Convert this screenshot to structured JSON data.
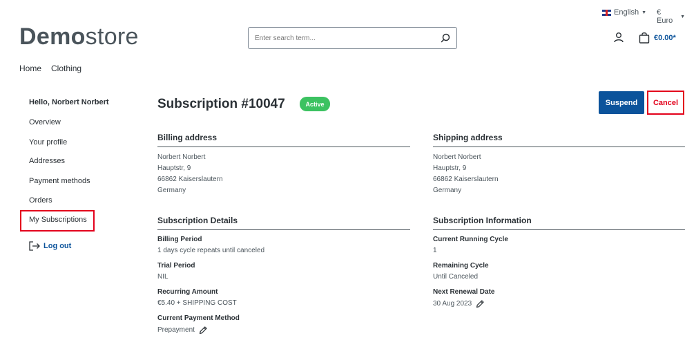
{
  "topbar": {
    "language": "English",
    "currency": "€ Euro"
  },
  "header": {
    "logo_bold": "Demo",
    "logo_light": "store",
    "search_placeholder": "Enter search term...",
    "cart_total": "€0.00*"
  },
  "nav": {
    "items": [
      "Home",
      "Clothing"
    ]
  },
  "sidebar": {
    "greeting": "Hello, Norbert Norbert",
    "items": [
      "Overview",
      "Your profile",
      "Addresses",
      "Payment methods",
      "Orders",
      "My Subscriptions"
    ],
    "logout": "Log out"
  },
  "subscription": {
    "title": "Subscription #10047",
    "status": "Active",
    "suspend_label": "Suspend",
    "cancel_label": "Cancel",
    "colors": {
      "accent": "#0b539b",
      "active": "#3cc261",
      "danger": "#e3001b"
    }
  },
  "billing_address": {
    "heading": "Billing address",
    "lines": [
      "Norbert Norbert",
      "Hauptstr, 9",
      "66862 Kaiserslautern",
      "Germany"
    ]
  },
  "shipping_address": {
    "heading": "Shipping address",
    "lines": [
      "Norbert Norbert",
      "Hauptstr, 9",
      "66862 Kaiserslautern",
      "Germany"
    ]
  },
  "details": {
    "heading": "Subscription Details",
    "billing_period_label": "Billing Period",
    "billing_period_value": "1 days cycle repeats until canceled",
    "trial_period_label": "Trial Period",
    "trial_period_value": "NIL",
    "recurring_amount_label": "Recurring Amount",
    "recurring_amount_value": "€5.40 + SHIPPING COST",
    "payment_method_label": "Current Payment Method",
    "payment_method_value": "Prepayment"
  },
  "information": {
    "heading": "Subscription Information",
    "running_cycle_label": "Current Running Cycle",
    "running_cycle_value": "1",
    "remaining_cycle_label": "Remaining Cycle",
    "remaining_cycle_value": "Until Canceled",
    "renewal_label": "Next Renewal Date",
    "renewal_value": "30 Aug 2023"
  }
}
